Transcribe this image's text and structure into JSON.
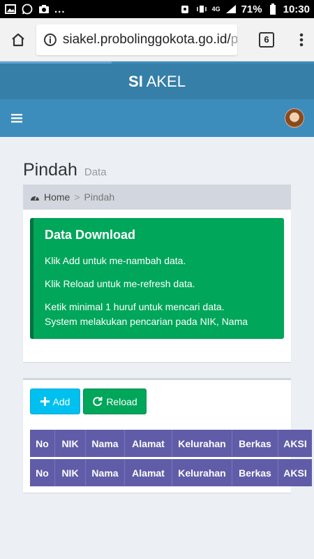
{
  "statusbar": {
    "dots": "...",
    "network": "4G",
    "battery": "71%",
    "time": "10:30"
  },
  "browser": {
    "url_main": "siakel.probolinggokota.go.id/",
    "url_fade": "p",
    "tab_count": "6"
  },
  "app": {
    "logo_bold": "SI",
    "logo_rest": " AKEL"
  },
  "page": {
    "title": "Pindah",
    "subtitle": "Data"
  },
  "breadcrumb": {
    "home": "Home",
    "separator": ">",
    "current": "Pindah"
  },
  "callout": {
    "title": "Data Download",
    "line1": "Klik Add untuk me-nambah data.",
    "line2": "Klik Reload untuk me-refresh data.",
    "line3": "Ketik minimal 1 huruf untuk mencari data.",
    "line4": "System melakukan pencarian pada NIK, Nama"
  },
  "buttons": {
    "add": "Add",
    "reload": "Reload"
  },
  "table": {
    "columns": [
      "No",
      "NIK",
      "Nama",
      "Alamat",
      "Kelurahan",
      "Berkas",
      "AKSI"
    ]
  },
  "colors": {
    "header_dark": "#367fa9",
    "header": "#3c8dbc",
    "success": "#00a65a",
    "info": "#00c0ef",
    "table_header": "#605ca8"
  }
}
